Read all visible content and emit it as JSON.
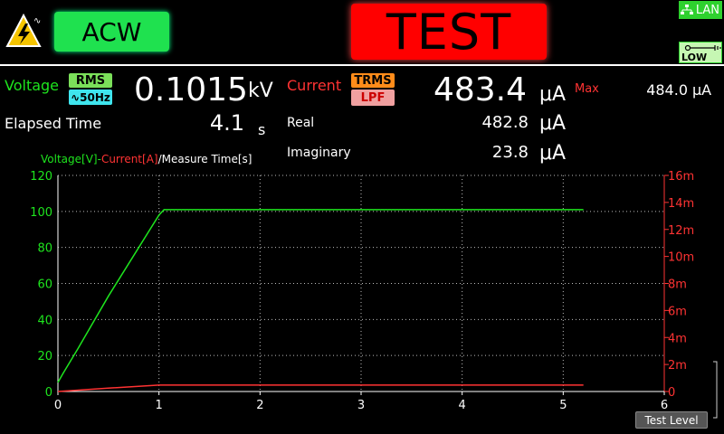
{
  "header": {
    "mode": "ACW",
    "status": "TEST",
    "lan_label": "LAN",
    "low_label": "LOW"
  },
  "voltage": {
    "label": "Voltage",
    "rms_tag": "RMS",
    "filter_tag": "∿50Hz",
    "value": "0.1015",
    "unit": "kV"
  },
  "elapsed": {
    "label": "Elapsed Time",
    "value": "4.1",
    "unit": "s"
  },
  "current": {
    "label": "Current",
    "trms_tag": "TRMS",
    "lpf_tag": "LPF",
    "value": "483.4",
    "unit": "μA",
    "max_label": "Max",
    "max_value": "484.0",
    "max_unit": "μA"
  },
  "real": {
    "label": "Real",
    "value": "482.8",
    "unit": "μA"
  },
  "imaginary": {
    "label": "Imaginary",
    "value": "23.8",
    "unit": "μA"
  },
  "chart_legend": {
    "voltage": "Voltage[V]",
    "sep1": "-",
    "current": "Current[A]",
    "sep2": "/",
    "time": "Measure Time[s]"
  },
  "test_level_button": "Test Level",
  "colors": {
    "voltage": "#1ee51e",
    "current": "#ff3333",
    "mode": "#1fe14f",
    "status": "#ff0000"
  },
  "chart_data": {
    "type": "line",
    "x_range": [
      0,
      6
    ],
    "x_ticks": [
      "0",
      "1",
      "2",
      "3",
      "4",
      "5",
      "6"
    ],
    "y_left_range": [
      0,
      120
    ],
    "y_left_ticks": [
      "0",
      "20",
      "40",
      "60",
      "80",
      "100",
      "120"
    ],
    "y_right_range": [
      0,
      16
    ],
    "y_right_ticks": [
      "0",
      "2m",
      "4m",
      "6m",
      "8m",
      "10m",
      "12m",
      "14m",
      "16m"
    ],
    "grid": true,
    "series": [
      {
        "name": "Voltage[V]",
        "axis": "left",
        "x": [
          0,
          0.05,
          0.2,
          0.5,
          0.8,
          1.0,
          1.05,
          2,
          3,
          4,
          5,
          5.2
        ],
        "y": [
          5,
          10,
          24,
          53,
          80,
          98,
          101,
          101,
          101,
          101,
          101,
          101
        ]
      },
      {
        "name": "Current[A]",
        "axis": "right",
        "x": [
          0,
          0.5,
          1.0,
          2,
          3,
          4,
          5,
          5.2
        ],
        "y": [
          0,
          0.25,
          0.48,
          0.48,
          0.48,
          0.48,
          0.48,
          0.48
        ]
      }
    ]
  }
}
